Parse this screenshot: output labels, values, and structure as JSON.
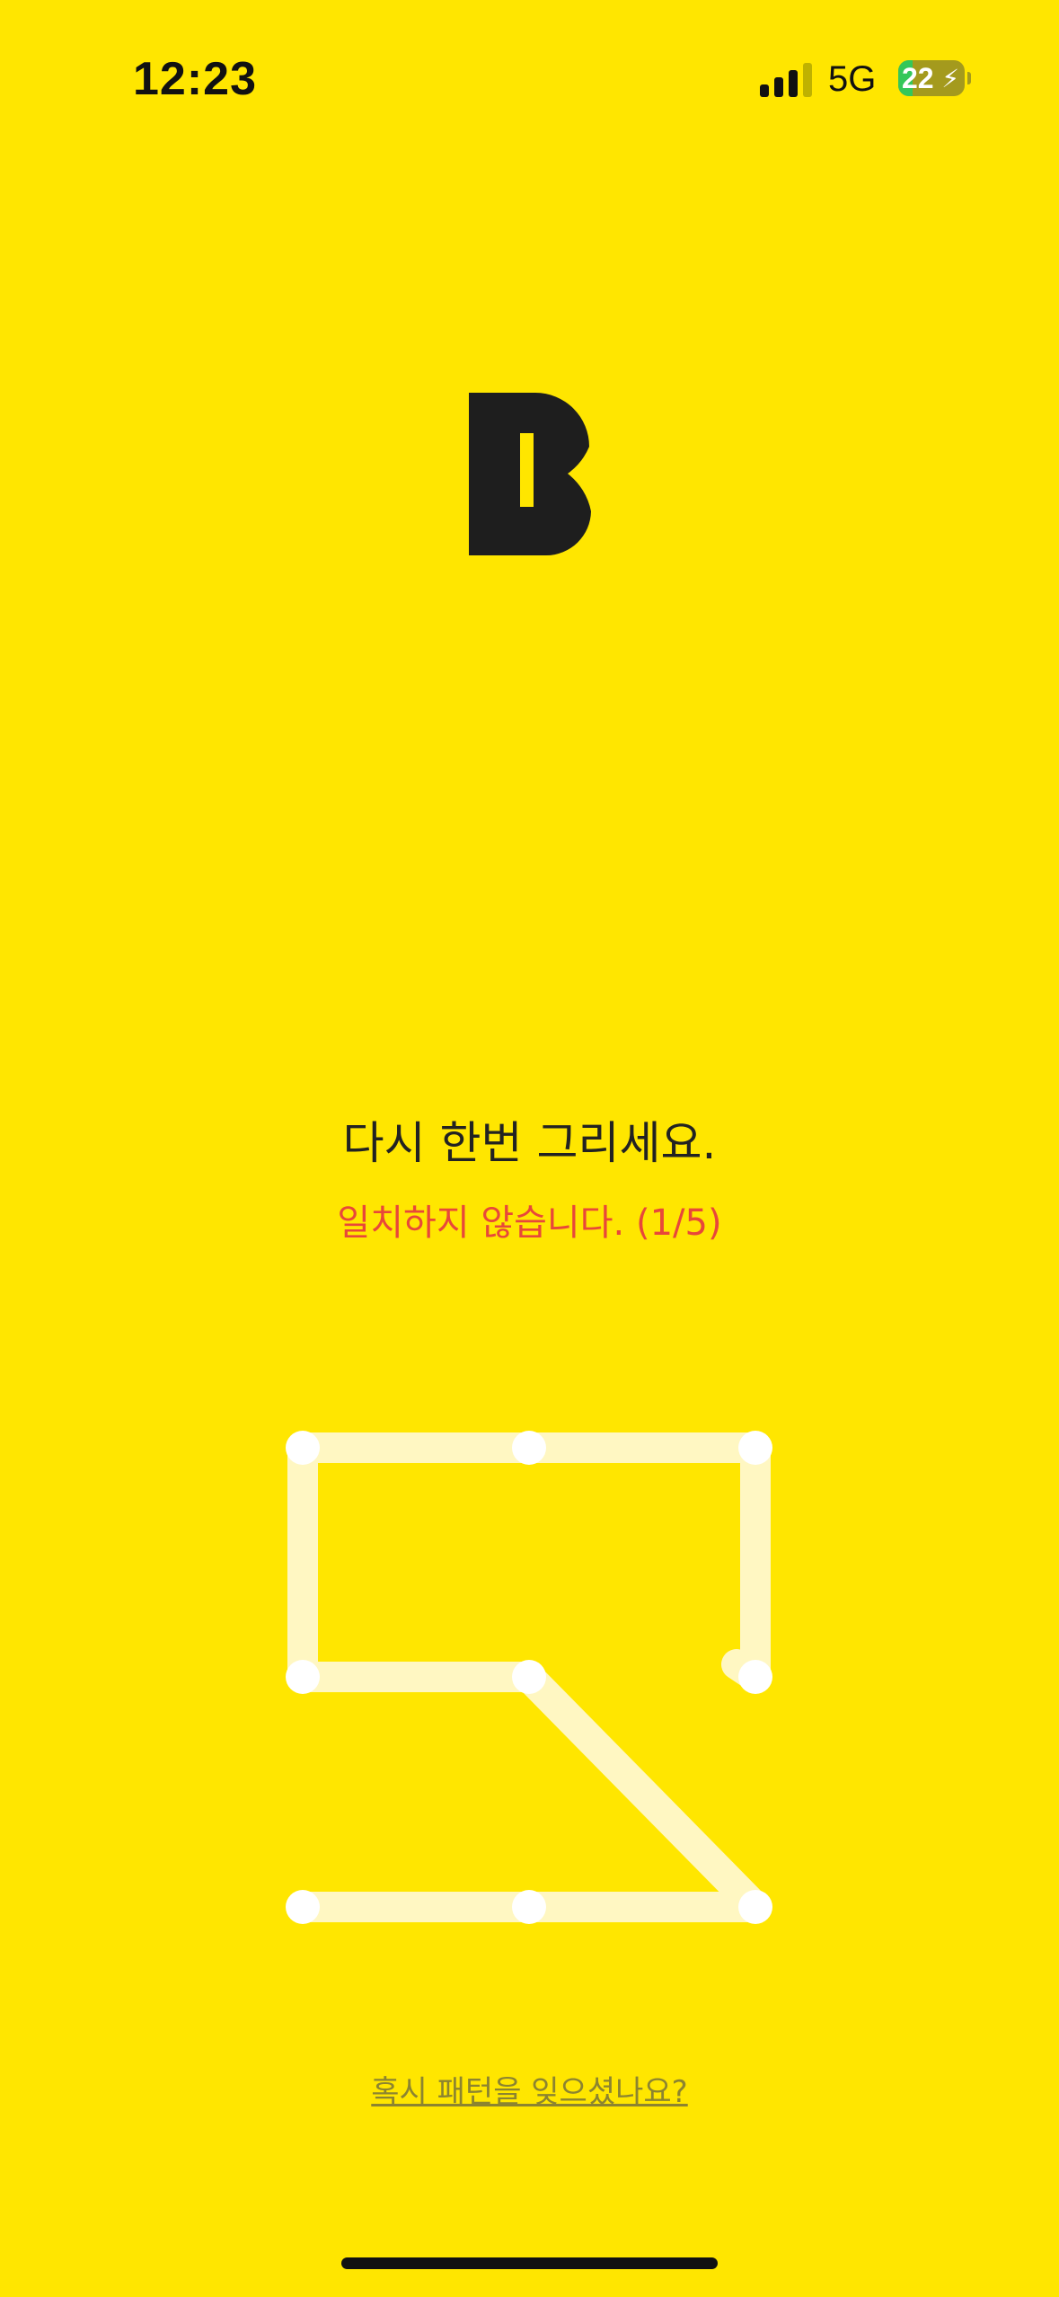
{
  "status_bar": {
    "time": "12:23",
    "network": "5G",
    "battery_level": "22",
    "signal_icon": "signal-bars-icon",
    "battery_icon": "battery-charging-icon"
  },
  "logo": {
    "icon": "bank-b-logo"
  },
  "pattern_screen": {
    "prompt": "다시 한번 그리세요.",
    "error": "일치하지 않습니다. (1/5)",
    "forgot_link": "혹시 패턴을 잊으셨나요?"
  },
  "pattern": {
    "grid": "3x3",
    "drawn_sequence": [
      4,
      1,
      2,
      3,
      6,
      5,
      9,
      8,
      7
    ],
    "colors": {
      "background": "#FFE600",
      "line": "#FFF7C2",
      "dot": "#FFFFFF",
      "error_text": "#E8473A"
    }
  }
}
